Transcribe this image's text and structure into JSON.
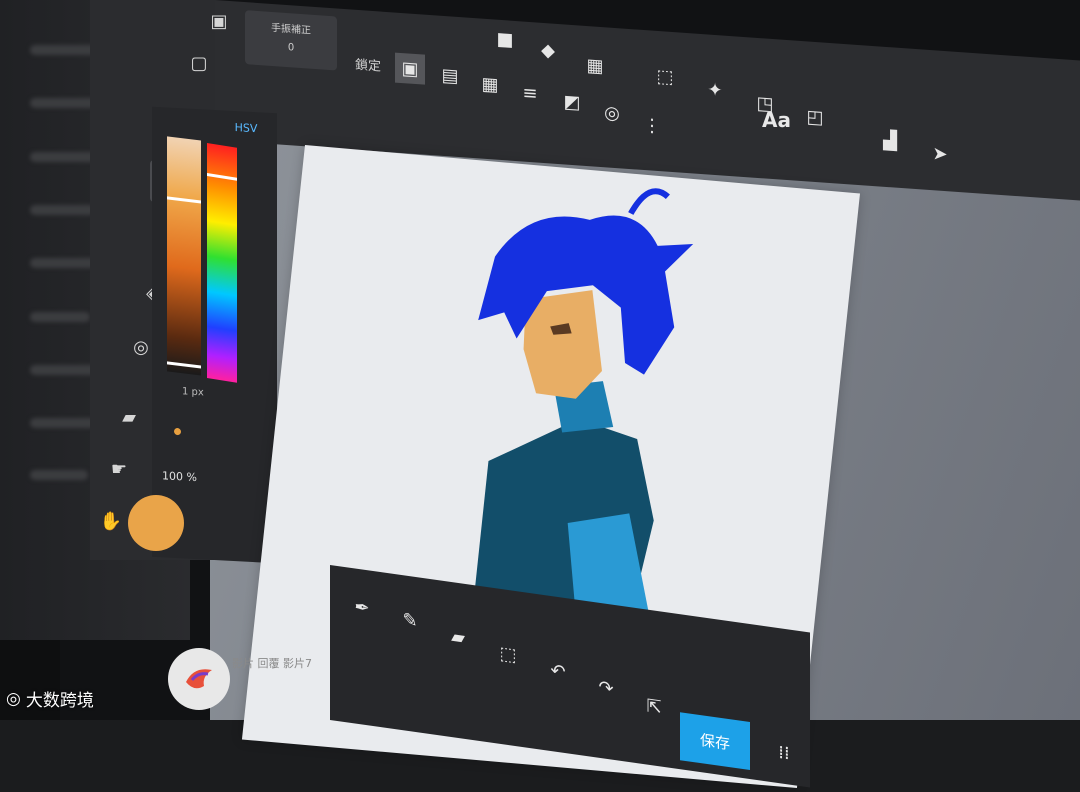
{
  "toolbar": {
    "stabilizer_label": "手振補正",
    "stabilizer_value": "0",
    "lock_label": "鎖定",
    "text_tool_label": "Aa",
    "icons": [
      "pen-mode-icon",
      "hatch-ruler-icon",
      "grid-ruler-icon",
      "line-ruler-icon",
      "perspective-ruler-icon",
      "concentric-ruler-icon",
      "more-vert-icon",
      "rect-select-icon",
      "magic-wand-icon",
      "lasso-select-icon",
      "select-pen-icon",
      "layout-icon",
      "pointer-icon"
    ]
  },
  "tool_rail": {
    "icons": [
      "frame-icon",
      "selection-rect-icon",
      "circle-icon",
      "pencil-icon",
      "blur-icon",
      "fill-icon",
      "ring-icon",
      "eraser-icon",
      "smudge-icon",
      "hand-icon"
    ],
    "active": "pencil-icon"
  },
  "color_panel": {
    "mode_tab": "HSV",
    "size_value": "1 px",
    "opacity_value": "100 %",
    "current_color": "#e9a449",
    "hue_colors": [
      "#ff2020",
      "#ff9000",
      "#ffee00",
      "#30e030",
      "#00c8ff",
      "#2040ff",
      "#b020ff"
    ]
  },
  "bottom_bar": {
    "save_label": "保存",
    "icons": [
      "eyedropper-icon",
      "pen-icon",
      "eraser-icon",
      "transform-icon",
      "undo-icon",
      "redo-icon",
      "export-icon",
      "grid-icon"
    ]
  },
  "taskbar": {
    "text": "影片 回覆 影片7"
  },
  "watermark": {
    "text": "大数跨境"
  },
  "colors": {
    "accent": "#1da1e8",
    "hair": "#1530e0",
    "skin": "#e8ae65",
    "shirt": "#2a9ad4",
    "vest": "#124e6a"
  }
}
